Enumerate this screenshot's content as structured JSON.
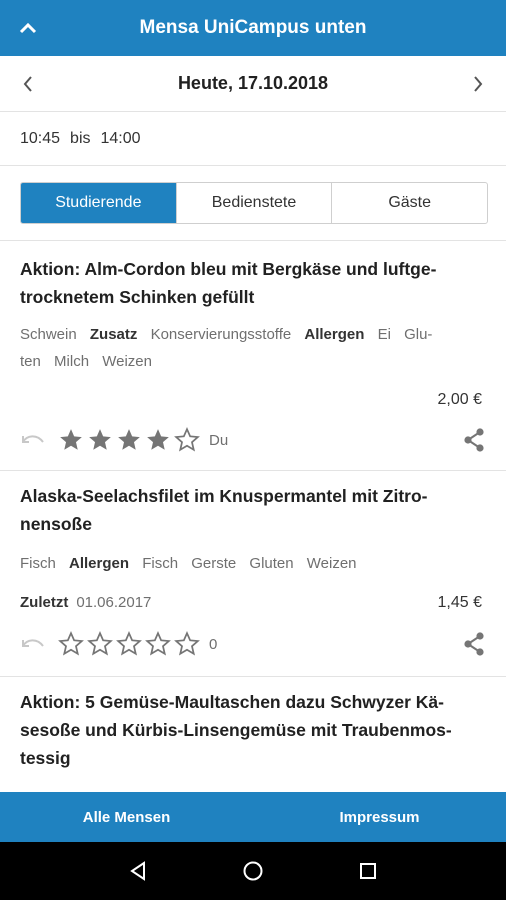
{
  "app_bar": {
    "title": "Mensa UniCampus unten",
    "up_icon": "chevron-up-icon"
  },
  "date_nav": {
    "label": "Heute, 17.10.2018"
  },
  "opening_hours": {
    "from": "10:45",
    "sep": "bis",
    "to": "14:00"
  },
  "audience_tabs": [
    {
      "label": "Studierende",
      "selected": true
    },
    {
      "label": "Bedienstete",
      "selected": false
    },
    {
      "label": "Gäste",
      "selected": false
    }
  ],
  "meals": [
    {
      "name_lines": [
        "Aktion: Alm-Cordon bleu mit Bergkäse und luftge-",
        "trocknetem Schinken gefüllt"
      ],
      "tag_rows": [
        [
          {
            "text": "Schwein",
            "bold": false
          },
          {
            "text": "Zusatz",
            "bold": true
          },
          {
            "text": "Konservierungsstoffe",
            "bold": false
          },
          {
            "text": "Allergen",
            "bold": true
          },
          {
            "text": "Ei",
            "bold": false
          },
          {
            "text": "Glu-",
            "bold": false
          }
        ],
        [
          {
            "text": "ten",
            "bold": false
          },
          {
            "text": "Milch",
            "bold": false
          },
          {
            "text": "Weizen",
            "bold": false
          }
        ]
      ],
      "price": "2,00 €",
      "rating_stars": 4,
      "rating_label": "Du"
    },
    {
      "name_lines": [
        "Alaska-Seelachsfilet im Knuspermantel mit Zitro-",
        "nensoße"
      ],
      "tag_rows": [
        [
          {
            "text": "Fisch",
            "bold": false
          },
          {
            "text": "Allergen",
            "bold": true
          },
          {
            "text": "Fisch",
            "bold": false
          },
          {
            "text": "Gerste",
            "bold": false
          },
          {
            "text": "Gluten",
            "bold": false
          },
          {
            "text": "Weizen",
            "bold": false
          }
        ]
      ],
      "last_label": "Zuletzt",
      "last_date": "01.06.2017",
      "price": "1,45 €",
      "rating_stars": 0,
      "rating_label": "0"
    },
    {
      "name_lines": [
        "Aktion: 5 Gemüse-Maultaschen dazu Schwyzer Kä-",
        "sesoße und Kürbis-Linsengemüse mit Traubenmos-",
        "tessig"
      ]
    }
  ],
  "bottom_nav": {
    "left": "Alle Mensen",
    "right": "Impressum"
  },
  "colors": {
    "primary": "#1f82c0",
    "star": "#757575"
  }
}
